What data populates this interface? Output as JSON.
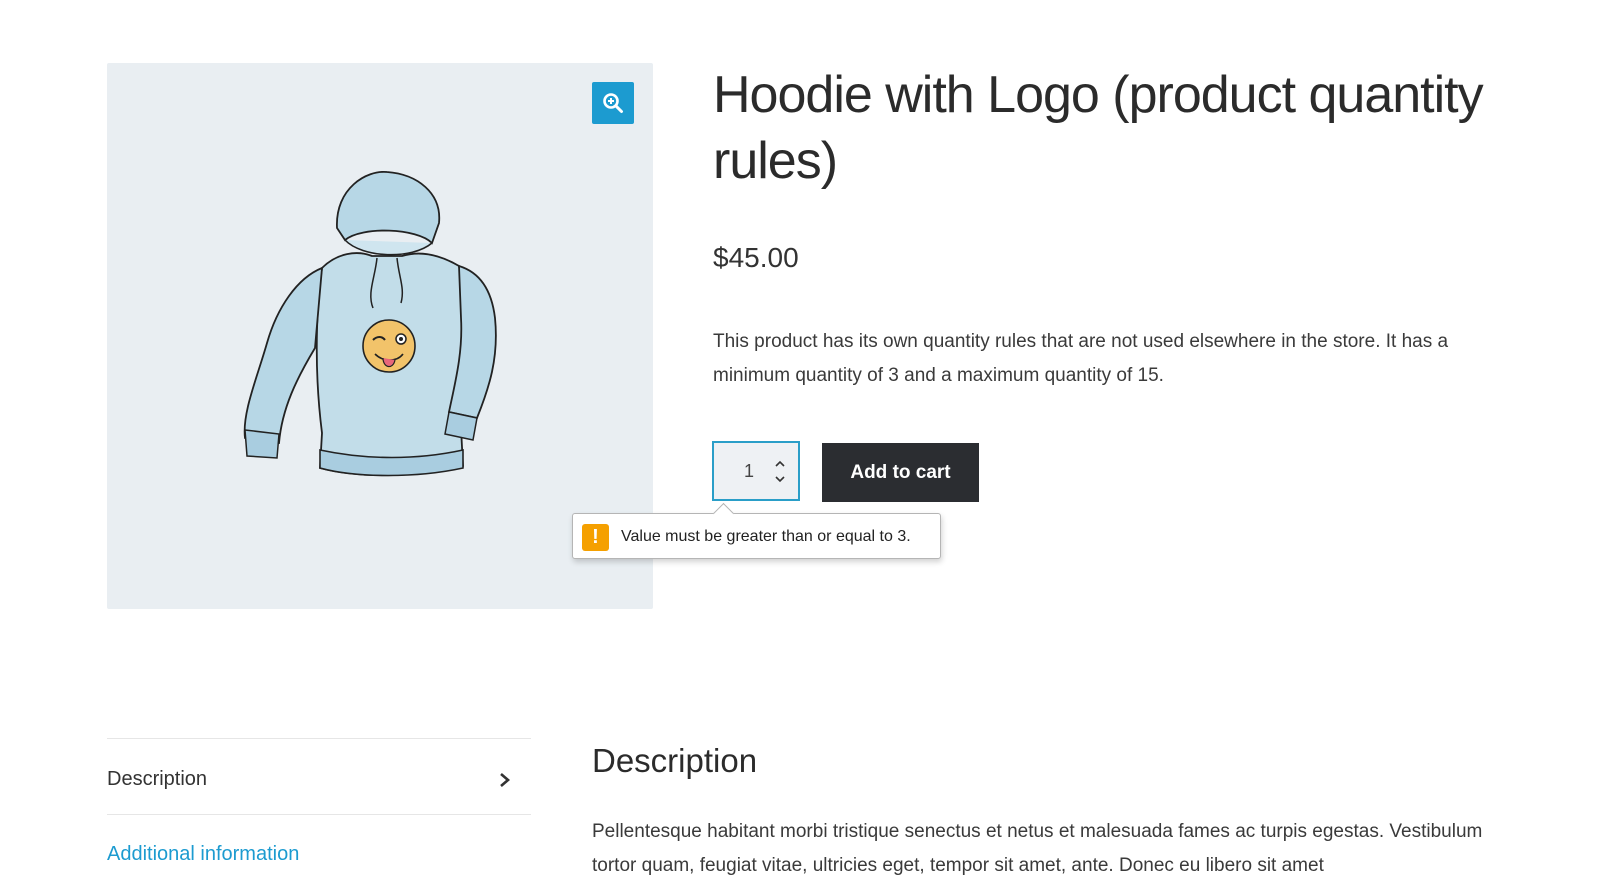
{
  "product": {
    "title": "Hoodie with Logo (product quantity rules)",
    "price": "$45.00",
    "short_description": "This product has its own quantity rules that are not used elsewhere in the store. It has a minimum quantity of 3 and a maximum quantity of 15.",
    "image_icon": "hoodie-with-winking-emoji",
    "zoom_icon": "zoom-in-icon"
  },
  "cart": {
    "quantity": "1",
    "add_to_cart_label": "Add to cart",
    "validation_message": "Value must be greater than or equal to 3.",
    "warning_symbol": "!"
  },
  "tabs": {
    "items": [
      {
        "label": "Description",
        "active": true
      },
      {
        "label": "Additional information",
        "active": false
      }
    ]
  },
  "description": {
    "heading": "Description",
    "body": "Pellentesque habitant morbi tristique senectus et netus et malesuada fames ac turpis egestas. Vestibulum tortor quam, feugiat vitae, ultricies eget, tempor sit amet, ante. Donec eu libero sit amet"
  },
  "colors": {
    "accent": "#1c9bd0",
    "button": "#2b2d31",
    "warning": "#f5a000",
    "image_bg": "#e9eef2"
  }
}
